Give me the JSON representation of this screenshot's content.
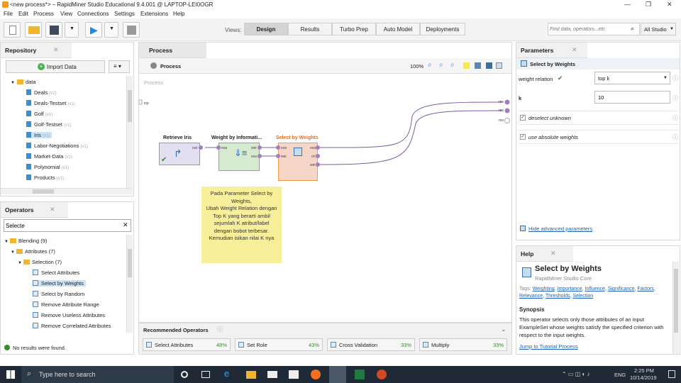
{
  "window": {
    "title": "<new process*> – RapidMiner Studio Educational 9.4.001 @ LAPTOP-LEI0OGR",
    "minimize": "—",
    "restore": "❐",
    "close": "✕"
  },
  "menu": [
    "File",
    "Edit",
    "Process",
    "View",
    "Connections",
    "Settings",
    "Extensions",
    "Help"
  ],
  "toolbar": {
    "views_label": "Views:",
    "views": [
      "Design",
      "Results",
      "Turbo Prep",
      "Auto Model",
      "Deployments"
    ],
    "search_placeholder": "Find data, operators...etc",
    "all_studio": "All Studio"
  },
  "repository": {
    "tab": "Repository",
    "import": "Import Data",
    "root": "data",
    "items": [
      {
        "name": "Deals",
        "ver": "(v1)"
      },
      {
        "name": "Deals-Testset",
        "ver": "(v1)"
      },
      {
        "name": "Golf",
        "ver": "(v1)"
      },
      {
        "name": "Golf-Testset",
        "ver": "(v1)"
      },
      {
        "name": "Iris",
        "ver": "(v1)"
      },
      {
        "name": "Labor-Negotiations",
        "ver": "(v1)"
      },
      {
        "name": "Market-Data",
        "ver": "(v1)"
      },
      {
        "name": "Polynomial",
        "ver": "(v1)"
      },
      {
        "name": "Products",
        "ver": "(v1)"
      }
    ]
  },
  "operators": {
    "tab": "Operators",
    "search_value": "Selecte",
    "tree": [
      {
        "label": "Blending (9)",
        "type": "folder"
      },
      {
        "label": "Attributes (7)",
        "type": "folder"
      },
      {
        "label": "Selection (7)",
        "type": "folder"
      },
      {
        "label": "Select Attributes",
        "type": "op"
      },
      {
        "label": "Select by Weights",
        "type": "op"
      },
      {
        "label": "Select by Random",
        "type": "op"
      },
      {
        "label": "Remove Attribute Range",
        "type": "op"
      },
      {
        "label": "Remove Useless Attributes",
        "type": "op"
      },
      {
        "label": "Remove Correlated Attributes",
        "type": "op"
      }
    ],
    "status": "No results were found."
  },
  "process": {
    "tab": "Process",
    "crumb": "Process",
    "zoom": "100%",
    "canvas_label": "Process",
    "inp_label": "inp",
    "res_labels": [
      "res",
      "res",
      "res"
    ],
    "ops": [
      {
        "name": "Retrieve Iris",
        "ports_out": [
          "out"
        ]
      },
      {
        "name": "Weight by Informati...",
        "ports_in": [
          "exa"
        ],
        "ports_out": [
          "wei",
          "exa"
        ]
      },
      {
        "name": "Select by Weights",
        "ports_in": [
          "exa",
          "wei"
        ],
        "ports_out": [
          "exa",
          "ori",
          "wei"
        ]
      }
    ],
    "note": "Pada Parameter Select by Weights,\nUbah Weight Relation dengan Top K yang berarti ambil sejumlah K atribut/label dengan bobot terbesar. Kemudian isikan nilai K nya"
  },
  "recommended": {
    "title": "Recommended Operators",
    "items": [
      {
        "name": "Select Attributes",
        "pct": "48%"
      },
      {
        "name": "Set Role",
        "pct": "43%"
      },
      {
        "name": "Cross Validation",
        "pct": "33%"
      },
      {
        "name": "Multiply",
        "pct": "33%"
      }
    ]
  },
  "parameters": {
    "tab": "Parameters",
    "operator": "Select by Weights",
    "weight_relation_label": "weight relation",
    "weight_relation_value": "top k",
    "k_label": "k",
    "k_value": "10",
    "deselect_unknown": "deselect unknown",
    "use_absolute": "use absolute weights",
    "hide_advanced": "Hide advanced parameters"
  },
  "help": {
    "tab": "Help",
    "title": "Select by Weights",
    "subtitle": "RapidMiner Studio Core",
    "tags_label": "Tags:",
    "tags": [
      "Weighting",
      "Importance",
      "Influence",
      "Significance",
      "Factors",
      "Relevance",
      "Thresholds",
      "Selection"
    ],
    "synopsis_title": "Synopsis",
    "synopsis": "This operator selects only those attributes of an input ExampleSet whose weights satisfy the specified criterion with respect to the input weights.",
    "tutorial": "Jump to Tutorial Process"
  },
  "taskbar": {
    "search": "Type here to search",
    "time": "2:25 PM",
    "date": "10/14/2019",
    "lang": "ENG"
  }
}
